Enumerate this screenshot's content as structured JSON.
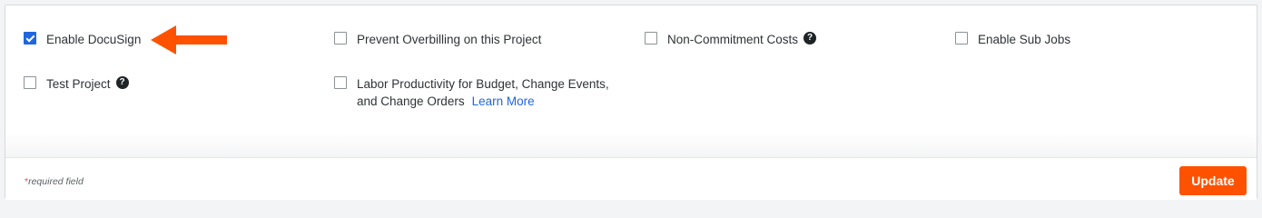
{
  "options": {
    "enable_docusign": {
      "label": "Enable DocuSign",
      "checked": true
    },
    "prevent_overbilling": {
      "label": "Prevent Overbilling on this Project",
      "checked": false
    },
    "non_commitment_costs": {
      "label": "Non-Commitment Costs",
      "checked": false,
      "help": "?"
    },
    "enable_sub_jobs": {
      "label": "Enable Sub Jobs",
      "checked": false
    },
    "test_project": {
      "label": "Test Project",
      "checked": false,
      "help": "?"
    },
    "labor_productivity": {
      "label_line1": "Labor Productivity for Budget, Change Events,",
      "label_line2": "and Change Orders",
      "link": "Learn More",
      "checked": false
    }
  },
  "footer": {
    "required_asterisk": "*",
    "required_text": "required field",
    "update_label": "Update"
  },
  "colors": {
    "accent": "#ff5200",
    "checkbox_checked": "#2066df",
    "link": "#2066df",
    "arrow": "#ff5200"
  },
  "icons": {
    "help": "question-circle-icon",
    "annotation": "left-arrow-icon"
  }
}
